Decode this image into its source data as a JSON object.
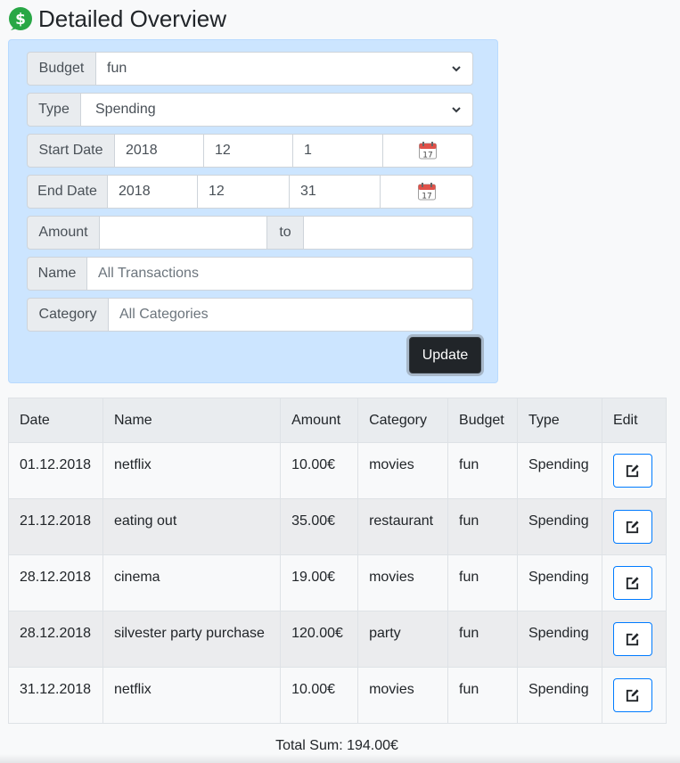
{
  "page": {
    "title": "Detailed Overview"
  },
  "filters": {
    "budget": {
      "label": "Budget",
      "value": "fun"
    },
    "type": {
      "label": "Type",
      "value": "Spending"
    },
    "start_date": {
      "label": "Start Date",
      "year": "2018",
      "month": "12",
      "day": "1"
    },
    "end_date": {
      "label": "End Date",
      "year": "2018",
      "month": "12",
      "day": "31"
    },
    "amount": {
      "label": "Amount",
      "to_label": "to",
      "min": "",
      "max": ""
    },
    "name": {
      "label": "Name",
      "placeholder": "All Transactions"
    },
    "category": {
      "label": "Category",
      "placeholder": "All Categories"
    },
    "update_label": "Update"
  },
  "table": {
    "headers": [
      "Date",
      "Name",
      "Amount",
      "Category",
      "Budget",
      "Type",
      "Edit"
    ],
    "rows": [
      {
        "date": "01.12.2018",
        "name": "netflix",
        "amount": "10.00€",
        "category": "movies",
        "budget": "fun",
        "type": "Spending"
      },
      {
        "date": "21.12.2018",
        "name": "eating out",
        "amount": "35.00€",
        "category": "restaurant",
        "budget": "fun",
        "type": "Spending"
      },
      {
        "date": "28.12.2018",
        "name": "cinema",
        "amount": "19.00€",
        "category": "movies",
        "budget": "fun",
        "type": "Spending"
      },
      {
        "date": "28.12.2018",
        "name": "silvester party purchase",
        "amount": "120.00€",
        "category": "party",
        "budget": "fun",
        "type": "Spending"
      },
      {
        "date": "31.12.2018",
        "name": "netflix",
        "amount": "10.00€",
        "category": "movies",
        "budget": "fun",
        "type": "Spending"
      }
    ]
  },
  "total": {
    "text": "Total Sum: 194.00€"
  },
  "icons": {
    "title": "dollar-circle-icon",
    "calendar": "calendar-icon",
    "edit": "edit-icon",
    "select": "chevron-down-icon"
  },
  "colors": {
    "panel_bg": "#cce5ff",
    "dollar_green": "#28a745",
    "edit_border": "#007bff",
    "update_bg": "#212529"
  }
}
